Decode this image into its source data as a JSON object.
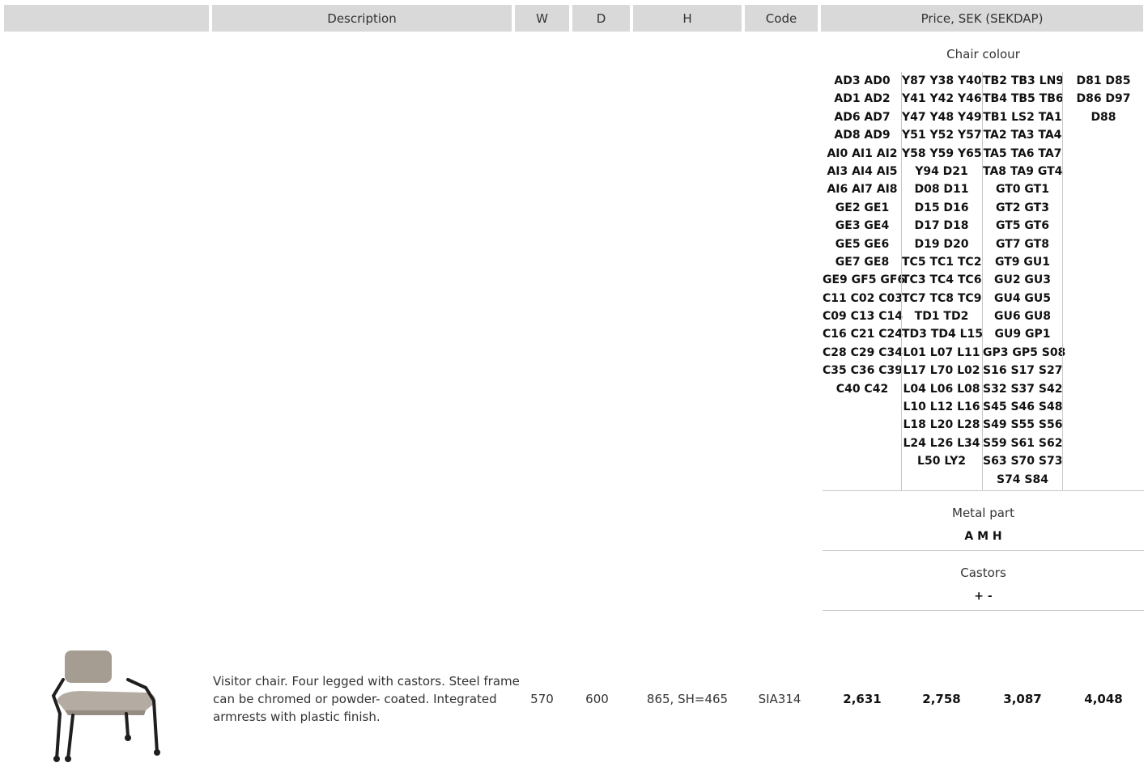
{
  "table_header": {
    "description": "Description",
    "width": "W",
    "depth": "D",
    "height": "H",
    "code": "Code",
    "price": "Price, SEK (SEKDAP)"
  },
  "options": {
    "chair_colour": {
      "label": "Chair colour",
      "groups": [
        [
          "AD3 AD0",
          "AD1 AD2",
          "AD6 AD7",
          "AD8 AD9",
          "AI0 AI1 AI2",
          "AI3 AI4 AI5",
          "AI6 AI7 AI8",
          "GE2 GE1",
          "GE3 GE4",
          "GE5 GE6",
          "GE7 GE8",
          "GE9 GF5 GF6",
          "C11 C02 C03",
          "C09 C13 C14",
          "C16 C21 C24",
          "C28 C29 C34",
          "C35 C36 C39",
          "C40 C42"
        ],
        [
          "Y87 Y38 Y40",
          "Y41 Y42 Y46",
          "Y47 Y48 Y49",
          "Y51 Y52 Y57",
          "Y58 Y59 Y65",
          "Y94 D21",
          "D08 D11",
          "D15 D16",
          "D17 D18",
          "D19 D20",
          "TC5 TC1 TC2",
          "TC3 TC4 TC6",
          "TC7 TC8 TC9",
          "TD1 TD2",
          "TD3 TD4 L15",
          "L01 L07 L11",
          "L17 L70 L02",
          "L04 L06 L08",
          "L10 L12 L16",
          "L18 L20 L28",
          "L24 L26 L34",
          "L50 LY2"
        ],
        [
          "TB2 TB3 LN9",
          "TB4 TB5 TB6",
          "TB1 LS2 TA1",
          "TA2 TA3 TA4",
          "TA5 TA6 TA7",
          "TA8 TA9 GT4",
          "GT0 GT1",
          "GT2 GT3",
          "GT5 GT6",
          "GT7 GT8",
          "GT9 GU1",
          "GU2 GU3",
          "GU4 GU5",
          "GU6 GU8",
          "GU9 GP1",
          "GP3 GP5 S08",
          "S16 S17 S27",
          "S32 S37 S42",
          "S45 S46 S48",
          "S49 S55 S56",
          "S59 S61 S62",
          "S63 S70 S73",
          "S74 S84"
        ],
        [
          "D81 D85",
          "D86 D97",
          "D88"
        ]
      ]
    },
    "metal_part": {
      "label": "Metal part",
      "values": "A M H"
    },
    "castors": {
      "label": "Castors",
      "values": "+ -"
    }
  },
  "product": {
    "image_icon": "chair-photo",
    "description": "Visitor chair. Four legged with castors. Steel frame can be chromed or powder- coated. Integrated armrests with plastic finish.",
    "width": "570",
    "depth": "600",
    "height": "865, SH=465",
    "code": "SIA314",
    "prices": [
      "2,631",
      "2,758",
      "3,087",
      "4,048"
    ]
  }
}
